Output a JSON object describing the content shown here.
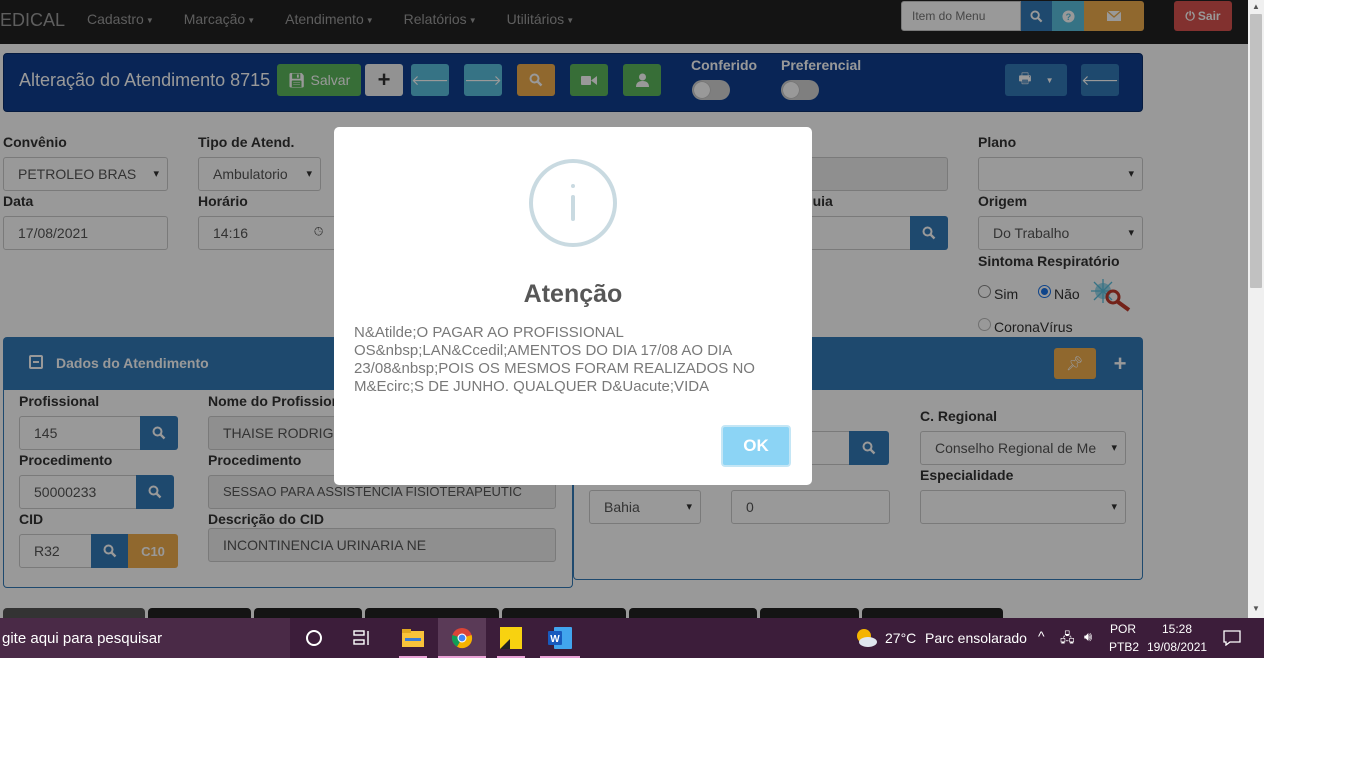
{
  "navbar": {
    "brand": "EDICAL",
    "menu": [
      "Cadastro",
      "Marcação",
      "Atendimento",
      "Relatórios",
      "Utilitários"
    ],
    "search_placeholder": "Item do Menu",
    "logout_label": "Sair"
  },
  "header": {
    "title": "Alteração do Atendimento 8715",
    "save_label": "Salvar",
    "conferido_label": "Conferido",
    "preferencial_label": "Preferencial"
  },
  "form": {
    "convenio_label": "Convênio",
    "convenio_value": "PETROLEO BRAS",
    "tipo_label": "Tipo de Atend.",
    "tipo_value": "Ambulatorio",
    "plano_label": "Plano",
    "plano_value": "",
    "data_label": "Data",
    "data_value": "17/08/2021",
    "horario_label": "Horário",
    "horario_value": "14:16",
    "guia_label": "a Guia",
    "origem_label": "Origem",
    "origem_value": "Do Trabalho",
    "sintoma_label": "Sintoma Respiratório",
    "sim_label": "Sim",
    "nao_label": "Não",
    "corona_label": "CoronaVírus"
  },
  "dados": {
    "panel_title": "Dados do Atendimento",
    "profissional_label": "Profissional",
    "profissional_value": "145",
    "nome_prof_label": "Nome do Profission",
    "nome_prof_value": "THAISE RODRIGU",
    "procedimento_label": "Procedimento",
    "procedimento_code": "50000233",
    "procedimento_desc_label": "Procedimento",
    "procedimento_desc": "SESSAO PARA ASSISTENCIA FISIOTERAPEUTIC",
    "cid_label": "CID",
    "cid_value": "R32",
    "c10_label": "C10",
    "cid_desc_label": "Descrição do CID",
    "cid_desc_value": "INCONTINENCIA URINARIA NE",
    "c_regional_label": "C. Regional",
    "c_regional_value": "Conselho Regional de Me",
    "uf_value": "Bahia",
    "num_value": "0",
    "especialidade_label": "Especialidade",
    "especialidade_value": ""
  },
  "modal": {
    "title": "Atenção",
    "message": "N&Atilde;O PAGAR AO PROFISSIONAL OS&nbsp;LAN&Ccedil;AMENTOS DO DIA 17/08 AO DIA 23/08&nbsp;POIS OS MESMOS FORAM REALIZADOS NO M&Ecirc;S DE JUNHO. QUALQUER D&Uacute;VIDA",
    "ok_label": "OK"
  },
  "taskbar": {
    "search_text": "gite aqui para pesquisar",
    "weather_temp": "27°C",
    "weather_desc": "Parc ensolarado",
    "lang_top": "POR",
    "lang_bottom": "PTB2",
    "time": "15:28",
    "date": "19/08/2021"
  }
}
